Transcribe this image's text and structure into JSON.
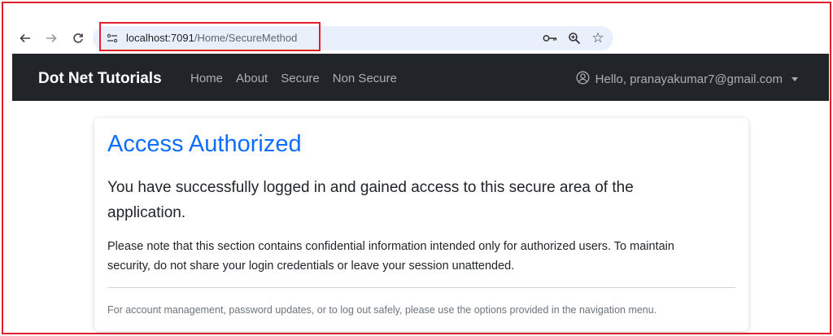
{
  "browser": {
    "url_host": "localhost:7091",
    "url_path": "/Home/SecureMethod"
  },
  "navbar": {
    "brand": "Dot Net Tutorials",
    "links": [
      "Home",
      "About",
      "Secure",
      "Non Secure"
    ],
    "user_greeting": "Hello, pranayakumar7@gmail.com"
  },
  "card": {
    "title": "Access Authorized",
    "lead": "You have successfully logged in and gained access to this secure area of the application.",
    "body": "Please note that this section contains confidential information intended only for authorized users. To maintain security, do not share your login credentials or leave your session unattended.",
    "footer": "For account management, password updates, or to log out safely, please use the options provided in the navigation menu."
  },
  "colors": {
    "highlight_border": "#e0202a",
    "navbar_bg": "#212529",
    "title_blue": "#0d6efd"
  },
  "icons": [
    "back-arrow-icon",
    "forward-arrow-icon",
    "reload-icon",
    "site-info-icon",
    "key-icon",
    "zoom-icon",
    "star-icon",
    "user-circle-icon",
    "caret-down-icon"
  ]
}
